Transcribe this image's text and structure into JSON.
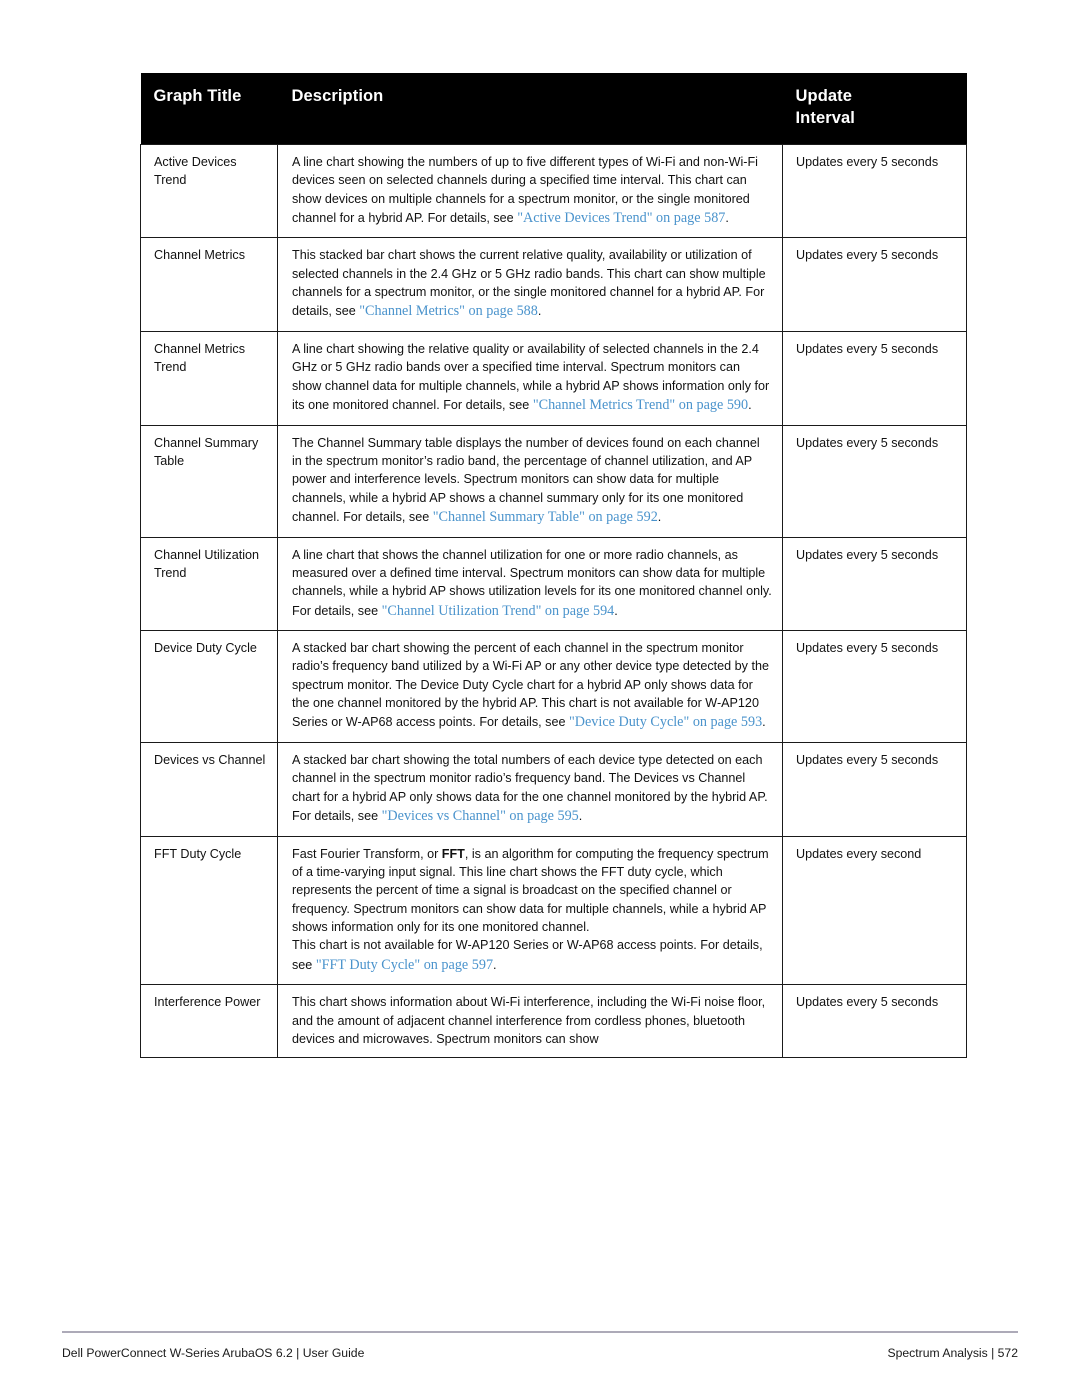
{
  "table": {
    "columns": [
      {
        "key": "graph_title",
        "label": "Graph Title"
      },
      {
        "key": "description",
        "label": "Description"
      },
      {
        "key": "update_interval",
        "label": "Update\nInterval"
      }
    ],
    "header": {
      "graph_title": "Graph Title",
      "description": "Description",
      "update_interval_line1": "Update",
      "update_interval_line2": "Interval"
    },
    "rows": [
      {
        "graph_title": "Active Devices Trend",
        "description_plain": "A line chart showing the numbers of up to five different types of Wi-Fi and non-Wi-Fi devices seen on selected channels during a specified time interval. This chart can show devices on multiple channels for a spectrum monitor, or the single monitored channel for a hybrid AP. For details, see ",
        "xref": "\"Active Devices Trend\" on page 587",
        "description_tail": ".",
        "update_interval": "Updates every 5 seconds"
      },
      {
        "graph_title": "Channel Metrics",
        "description_plain": "This stacked bar chart shows the current relative quality, availability or utilization of selected channels in the 2.4 GHz or 5 GHz radio bands. This chart can show multiple channels for a spectrum monitor, or the single monitored channel for a hybrid AP. For details, see ",
        "xref": "\"Channel Metrics\" on page 588",
        "description_tail": ".",
        "update_interval": "Updates every 5 seconds"
      },
      {
        "graph_title": "Channel Metrics Trend",
        "description_plain": "A line chart showing the relative quality or availability of selected channels in the 2.4 GHz or 5 GHz radio bands over a specified time interval. Spectrum monitors can show channel data for multiple channels, while a hybrid AP shows information only for its one monitored channel. For details, see ",
        "xref": "\"Channel Metrics Trend\" on page 590",
        "description_tail": ".",
        "update_interval": "Updates every 5 seconds"
      },
      {
        "graph_title": "Channel Summary Table",
        "description_plain": "The Channel Summary table displays the number of devices found on each channel in the spectrum monitor’s radio band, the percentage of channel utilization, and AP power and interference levels. Spectrum monitors can show data for multiple channels, while a hybrid AP shows a channel summary only for its one monitored channel. For details, see ",
        "xref": "\"Channel Summary Table\" on page 592",
        "description_tail": ".",
        "update_interval": "Updates every 5 seconds"
      },
      {
        "graph_title": "Channel Utilization Trend",
        "description_plain": "A line chart that shows the channel utilization for one or more radio channels, as measured over a defined time interval. Spectrum monitors can show data for multiple channels, while a hybrid AP shows utilization levels for its one monitored channel only. For details, see ",
        "xref": "\"Channel Utilization Trend\" on page 594",
        "description_tail": ".",
        "update_interval": "Updates every 5 seconds"
      },
      {
        "graph_title": "Device Duty Cycle",
        "description_plain": "A stacked bar chart showing the percent of each channel in the spectrum monitor radio’s frequency band utilized by a Wi-Fi AP or any other device type detected by the spectrum monitor. The Device Duty Cycle chart for a hybrid AP only shows data for the one channel monitored by the hybrid AP. This chart is not available for W-AP120 Series or W-AP68 access points. For details, see ",
        "xref": "\"Device Duty Cycle\" on page 593",
        "description_tail": ".",
        "update_interval": "Updates every 5 seconds"
      },
      {
        "graph_title": "Devices vs Channel",
        "description_plain": "A stacked bar chart showing the total numbers of each device type detected on each channel in the spectrum monitor radio’s frequency band. The Devices vs Channel chart for a hybrid AP only shows data for the one channel monitored by the hybrid AP. For details, see ",
        "xref": "\"Devices vs Channel\" on page 595",
        "description_tail": ".",
        "update_interval": "Updates every 5 seconds"
      },
      {
        "graph_title": "FFT Duty Cycle",
        "description_pre_bold": "Fast Fourier Transform, or ",
        "bold_term": "FFT",
        "description_plain": ", is an algorithm for computing the frequency spectrum of a time-varying input signal. This line chart shows the FFT duty cycle, which represents the percent of time a signal is broadcast on the specified channel or frequency. Spectrum monitors can show data for multiple channels, while a hybrid AP shows information only for its one monitored channel.",
        "description_para2": "This chart is not available for W-AP120 Series or W-AP68 access points. For details, see ",
        "xref": "\"FFT Duty Cycle\" on page 597",
        "description_tail": ".",
        "update_interval": "Updates every second"
      },
      {
        "graph_title": "Interference Power",
        "description_plain": "This chart shows information about Wi-Fi interference, including the Wi-Fi noise floor, and the amount of adjacent channel interference from cordless phones, bluetooth devices and microwaves. Spectrum monitors can show",
        "xref": "",
        "description_tail": "",
        "update_interval": "Updates every 5 seconds"
      }
    ]
  },
  "footer": {
    "left": "Dell PowerConnect W-Series ArubaOS 6.2 | User Guide",
    "right": "Spectrum Analysis | 572"
  },
  "colors": {
    "header_background": "#000000",
    "header_text": "#ffffff",
    "link": "#4a93cc",
    "border": "#1a1a1a",
    "footer_rule": "#adaab8"
  }
}
